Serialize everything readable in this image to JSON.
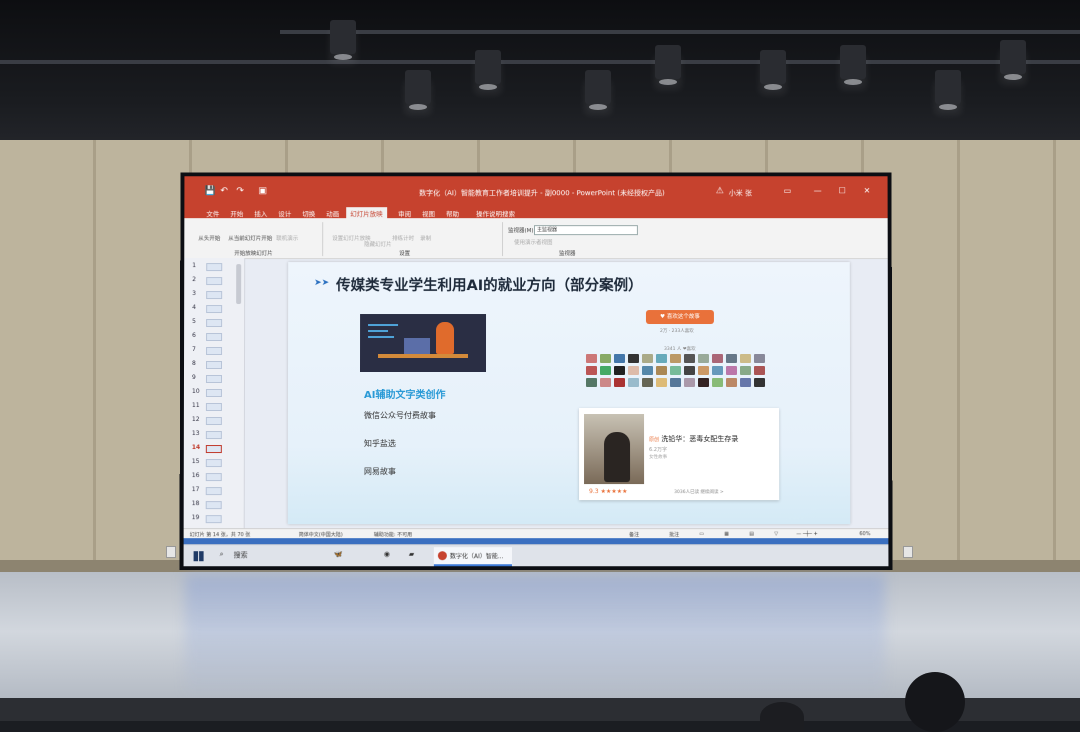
{
  "ppt": {
    "window_title": "数字化（AI）智能教育工作者培训提升 - 副0000 - PowerPoint (未经授权产品)",
    "user": "小米 张",
    "tabs": [
      "文件",
      "开始",
      "插入",
      "设计",
      "切换",
      "动画",
      "幻灯片放映",
      "审阅",
      "视图",
      "帮助",
      "操作说明搜索"
    ],
    "ribbon": {
      "from_start": "从头开始",
      "from_current": "从当前幻灯片开始",
      "online": "联机演示",
      "custom": "自定义幻灯片放映",
      "group_start": "开始放映幻灯片",
      "setup": "设置幻灯片放映",
      "hide": "隐藏幻灯片",
      "rehearse": "排练计时",
      "record": "录制",
      "group_setup": "设置",
      "monitor_label": "监视器(M):",
      "monitor_value": "主监视器",
      "presenter_view": "使用演示者视图",
      "group_monitor": "监视器"
    },
    "thumb_numbers": [
      "1",
      "2",
      "3",
      "4",
      "5",
      "6",
      "7",
      "8",
      "9",
      "10",
      "11",
      "12",
      "13",
      "14",
      "15",
      "16",
      "17",
      "18",
      "19"
    ],
    "selected_thumb": "14",
    "status": {
      "slide_info": "幻灯片 第 14 张，共 70 张",
      "language": "简体中文(中国大陆)",
      "accessibility": "辅助功能: 不可用",
      "notes": "备注",
      "comments": "批注",
      "zoom": "60%"
    }
  },
  "slide": {
    "title": "传媒类专业学生利用AI的就业方向（部分案例）",
    "subheading": "AI辅助文字类创作",
    "items": [
      "微信公众号付费故事",
      "知乎盐选",
      "网易故事"
    ],
    "button_text": "♥ 喜欢这个故事",
    "button_sub": "2万 · 233人喜欢",
    "avatars_caption": "3341 人 ❤喜欢",
    "card": {
      "tag": "原创",
      "title": "洗铅华：恶毒女配生存录",
      "meta": "6.2万字",
      "meta2": "女性故事",
      "rating": "9.3 ★★★★★",
      "read": "3036人已读  继续阅读 >"
    }
  },
  "taskbar": {
    "search": "搜索",
    "app_label": "数字化（AI）智能..."
  },
  "colors": {
    "ppt_red": "#c6422e",
    "accent_blue": "#2a9ad6",
    "orange": "#e9713a"
  }
}
